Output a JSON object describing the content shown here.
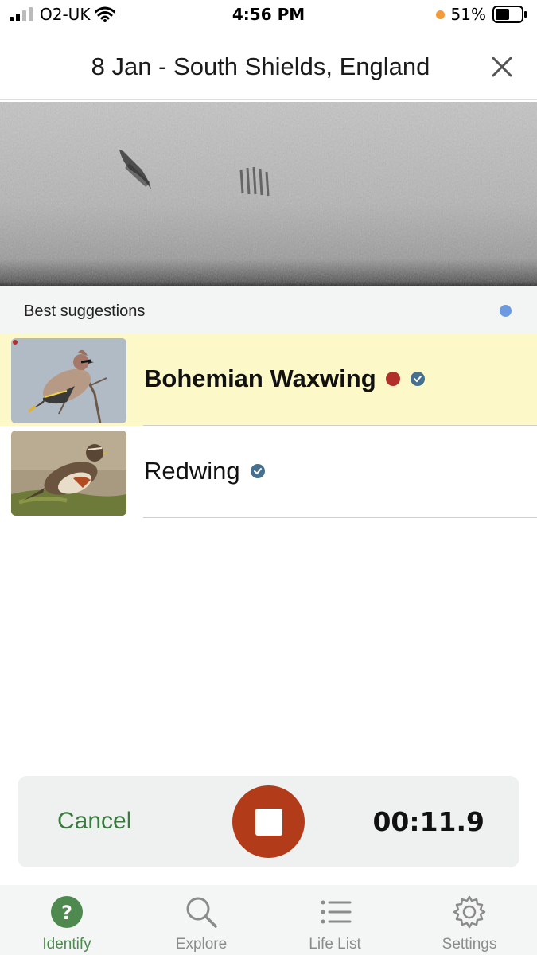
{
  "status_bar": {
    "carrier": "O2-UK",
    "time": "4:56 PM",
    "battery": "51%"
  },
  "header": {
    "title": "8 Jan - South Shields, England",
    "close_icon": "close-icon"
  },
  "suggestions": {
    "heading": "Best suggestions",
    "items": [
      {
        "name": "Bohemian Waxwing",
        "highlighted": true,
        "rare_marker": true,
        "verified": true,
        "thumbnail": "bohemian-waxwing-photo"
      },
      {
        "name": "Redwing",
        "highlighted": false,
        "rare_marker": false,
        "verified": true,
        "thumbnail": "redwing-photo"
      }
    ]
  },
  "recorder": {
    "cancel_label": "Cancel",
    "stop_icon": "stop-icon",
    "elapsed": "00:11.9"
  },
  "tabs": [
    {
      "label": "Identify",
      "icon": "question-icon",
      "active": true
    },
    {
      "label": "Explore",
      "icon": "search-icon",
      "active": false
    },
    {
      "label": "Life List",
      "icon": "list-icon",
      "active": false
    },
    {
      "label": "Settings",
      "icon": "gear-icon",
      "active": false
    }
  ],
  "colors": {
    "accent_green": "#4e8a4f",
    "record_red": "#b23b1a",
    "highlight_yellow": "#fdf8c7",
    "rare_dot": "#b0302a",
    "verify_blue": "#47708f"
  }
}
